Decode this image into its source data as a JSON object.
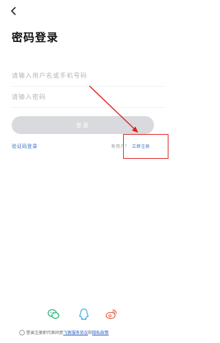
{
  "header": {
    "title": "密码登录"
  },
  "form": {
    "username_placeholder": "请输入用户名或手机号码",
    "password_placeholder": "请输入密码",
    "login_label": "登录"
  },
  "links": {
    "sms_login": "验证码登录",
    "new_user": "新用户？",
    "register": "立即注册"
  },
  "agreement": {
    "prefix": "登录注册即代表同意",
    "service_link": "飞客服务协议",
    "connector": "和",
    "privacy_link": "隐私政策"
  },
  "social_icons": [
    "wechat-icon",
    "qq-icon",
    "weibo-icon"
  ],
  "colors": {
    "link": "#3a6fc4",
    "button_disabled": "#d9dadd",
    "annotation": "#e02020"
  }
}
